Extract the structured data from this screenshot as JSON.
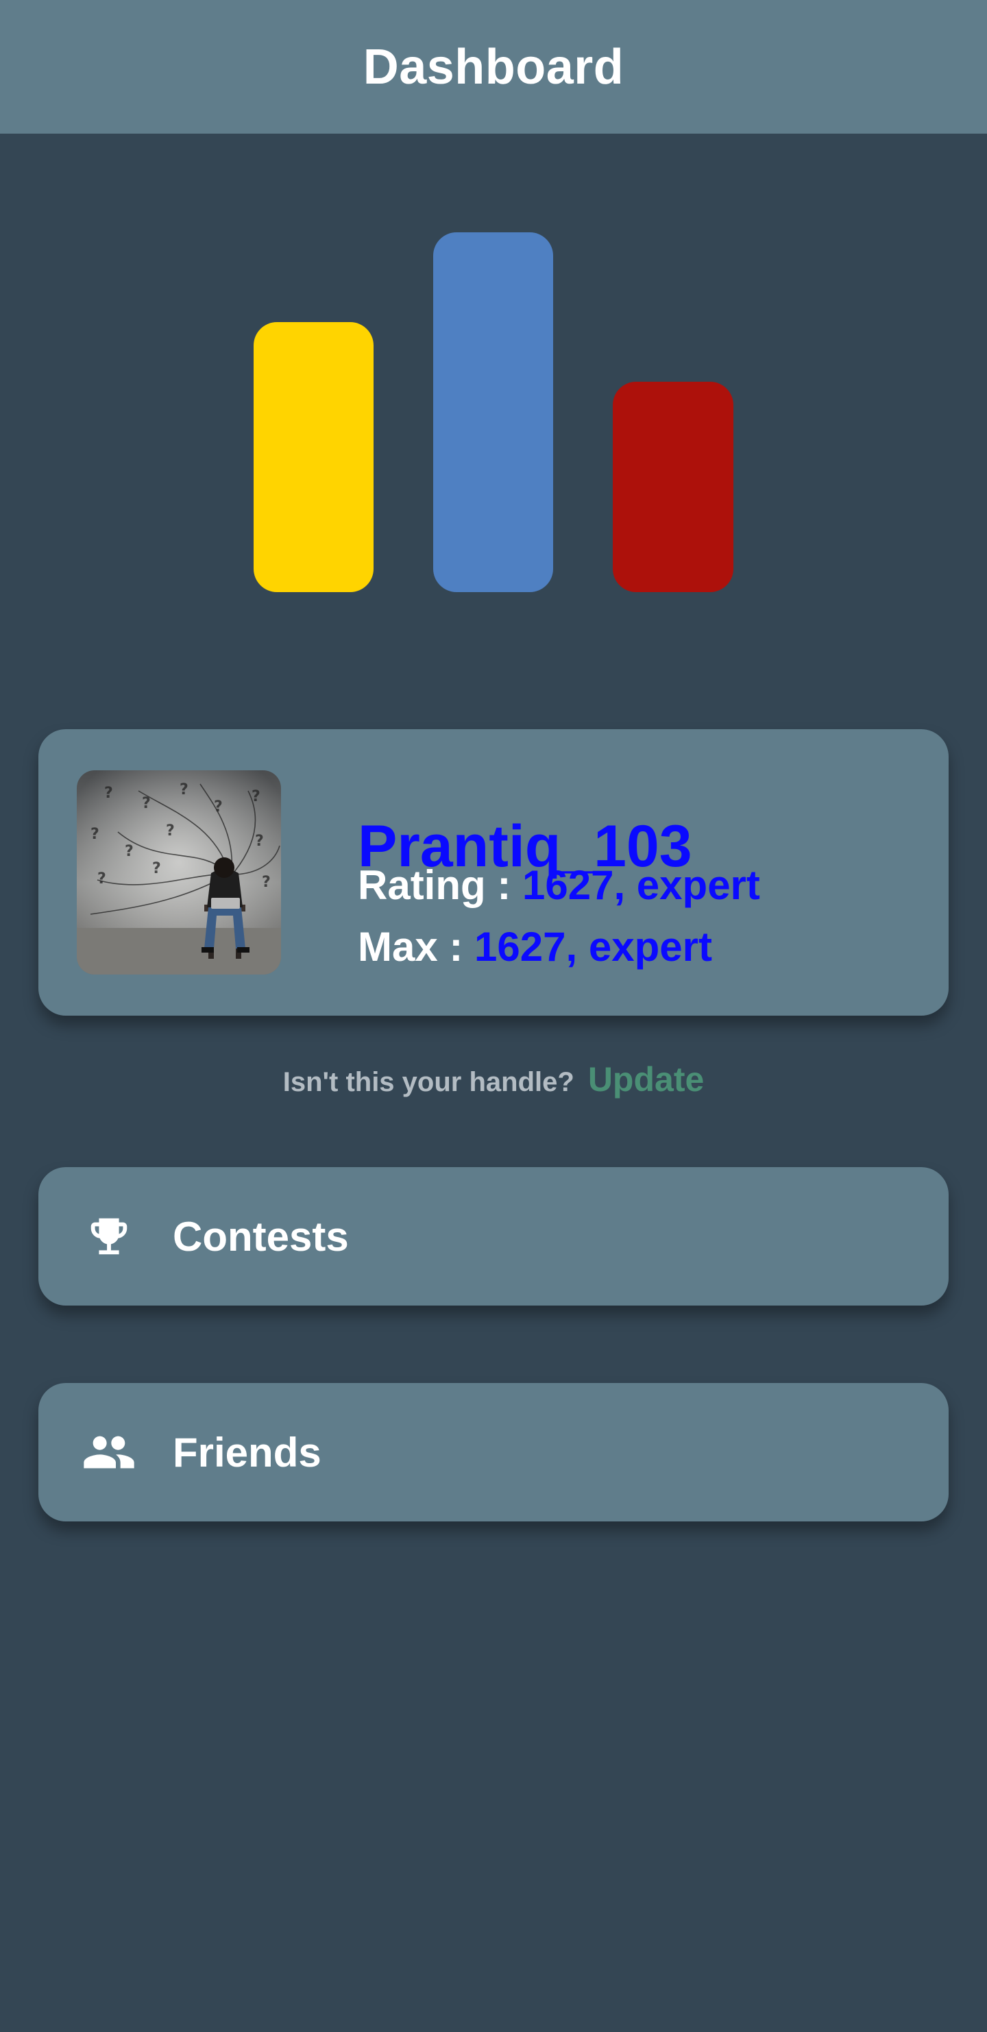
{
  "header": {
    "title": "Dashboard"
  },
  "logo": {
    "bars": [
      {
        "color": "#ffd400"
      },
      {
        "color": "#4f80c2"
      },
      {
        "color": "#ad110b"
      }
    ]
  },
  "profile": {
    "handle": "Prantiq_103",
    "rating_label": "Rating : ",
    "rating_value": "1627, expert",
    "max_label": "Max : ",
    "max_value": "1627, expert",
    "value_color": "#0a0aff"
  },
  "handle_prompt": {
    "question": "Isn't this your handle?",
    "action": "Update"
  },
  "menu": [
    {
      "label": "Contests",
      "icon": "trophy-icon"
    },
    {
      "label": "Friends",
      "icon": "people-icon"
    }
  ]
}
